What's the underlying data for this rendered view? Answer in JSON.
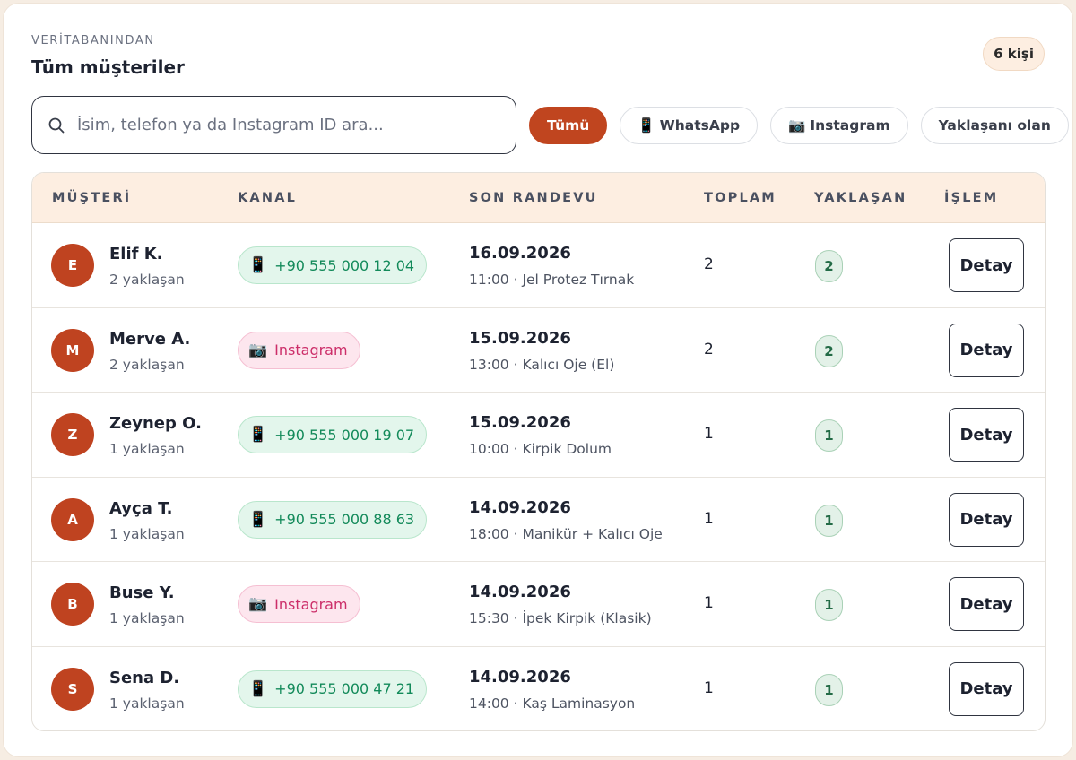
{
  "header": {
    "kicker": "VERİTABANINDAN",
    "title": "Tüm müşteriler",
    "count": "6 kişi"
  },
  "search": {
    "value": "",
    "placeholder": "İsim, telefon ya da Instagram ID ara..."
  },
  "filters": [
    {
      "label": "Tümü",
      "icon": "",
      "active": true
    },
    {
      "label": "WhatsApp",
      "icon": "📱",
      "active": false
    },
    {
      "label": "Instagram",
      "icon": "📷",
      "active": false
    },
    {
      "label": "Yaklaşanı olan",
      "icon": "",
      "active": false
    }
  ],
  "columns": [
    "MÜŞTERİ",
    "KANAL",
    "SON RANDEVU",
    "TOPLAM",
    "YAKLAŞAN",
    "İŞLEM"
  ],
  "detail_label": "Detay",
  "colors": {
    "accent": "#c0451f",
    "whatsapp": "#138a5a",
    "instagram": "#cc2e69"
  },
  "rows": [
    {
      "initial": "E",
      "name": "Elif K.",
      "sub": "2 yaklaşan",
      "channel": "whatsapp",
      "channel_icon": "📱",
      "channel_text": "+90 555 000 12 04",
      "date": "16.09.2026",
      "appt": "11:00 · Jel Protez Tırnak",
      "total": "2",
      "upcoming": "2"
    },
    {
      "initial": "M",
      "name": "Merve A.",
      "sub": "2 yaklaşan",
      "channel": "instagram",
      "channel_icon": "📷",
      "channel_text": "Instagram",
      "date": "15.09.2026",
      "appt": "13:00 · Kalıcı Oje (El)",
      "total": "2",
      "upcoming": "2"
    },
    {
      "initial": "Z",
      "name": "Zeynep O.",
      "sub": "1 yaklaşan",
      "channel": "whatsapp",
      "channel_icon": "📱",
      "channel_text": "+90 555 000 19 07",
      "date": "15.09.2026",
      "appt": "10:00 · Kirpik Dolum",
      "total": "1",
      "upcoming": "1"
    },
    {
      "initial": "A",
      "name": "Ayça T.",
      "sub": "1 yaklaşan",
      "channel": "whatsapp",
      "channel_icon": "📱",
      "channel_text": "+90 555 000 88 63",
      "date": "14.09.2026",
      "appt": "18:00 · Manikür + Kalıcı Oje",
      "total": "1",
      "upcoming": "1"
    },
    {
      "initial": "B",
      "name": "Buse Y.",
      "sub": "1 yaklaşan",
      "channel": "instagram",
      "channel_icon": "📷",
      "channel_text": "Instagram",
      "date": "14.09.2026",
      "appt": "15:30 · İpek Kirpik (Klasik)",
      "total": "1",
      "upcoming": "1"
    },
    {
      "initial": "S",
      "name": "Sena D.",
      "sub": "1 yaklaşan",
      "channel": "whatsapp",
      "channel_icon": "📱",
      "channel_text": "+90 555 000 47 21",
      "date": "14.09.2026",
      "appt": "14:00 · Kaş Laminasyon",
      "total": "1",
      "upcoming": "1"
    }
  ]
}
